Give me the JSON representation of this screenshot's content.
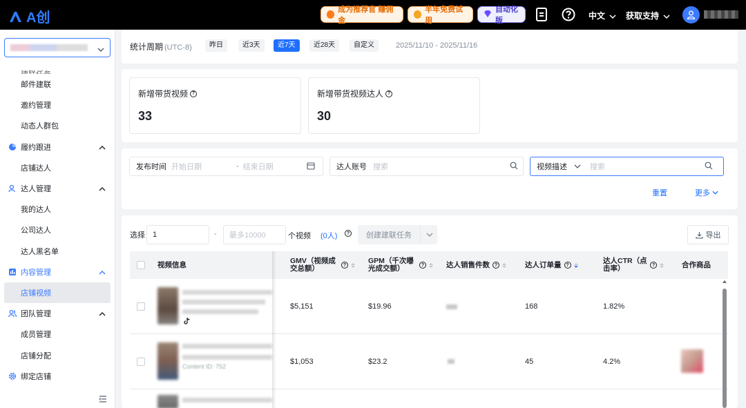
{
  "topbar": {
    "logo_text": "A创",
    "promo1": "成为推荐官 赚佣金",
    "promo2": "半年免费试用",
    "promo3": "自动化版",
    "lang": "中文",
    "support": "获取支持"
  },
  "sidebar": {
    "partial_item": "建联任务",
    "items_top": [
      "邮件建联",
      "邀约管理",
      "动态人群包"
    ],
    "groups": [
      {
        "label": "履约跟进",
        "items": [
          "店铺达人"
        ]
      },
      {
        "label": "达人管理",
        "items": [
          "我的达人",
          "公司达人",
          "达人黑名单"
        ]
      },
      {
        "label": "内容管理",
        "items": [
          "店铺视频"
        ]
      },
      {
        "label": "团队管理",
        "items": [
          "成员管理",
          "店铺分配"
        ]
      }
    ],
    "bottom_item": "绑定店铺"
  },
  "period": {
    "label": "统计周期",
    "timezone": "(UTC-8)",
    "chips": [
      "昨日",
      "近3天",
      "近7天",
      "近28天",
      "自定义"
    ],
    "active_chip": "近7天",
    "range": "2025/11/10 - 2025/11/16"
  },
  "stats": [
    {
      "title": "新增带货视频",
      "value": "33"
    },
    {
      "title": "新增带货视频达人",
      "value": "30"
    }
  ],
  "filters": {
    "publish_label": "发布时间",
    "start_placeholder": "开始日期",
    "separator": "-",
    "end_placeholder": "结束日期",
    "creator_label": "达人账号",
    "creator_placeholder": "搜索",
    "desc_select": "视频描述",
    "desc_placeholder": "搜索",
    "reset": "重置",
    "more": "更多"
  },
  "table_toolbar": {
    "select_label": "选择",
    "select_value": "1",
    "dash": "-",
    "max_placeholder": "最多10000",
    "unit": "个视频",
    "count": "(0人)",
    "create_task": "创建建联任务",
    "export": "导出"
  },
  "table": {
    "headers": [
      "视频信息",
      "GMV（视频成交总额）",
      "GPM（千次曝光成交额）",
      "达人销售件数",
      "达人订单量",
      "达人CTR（点击率）",
      "合作商品"
    ],
    "rows": [
      {
        "gmv": "$5,151",
        "gpm": "$19.96",
        "orders": "168",
        "ctr": "1.82%"
      },
      {
        "gmv": "$1,053",
        "gpm": "$23.2",
        "orders": "45",
        "ctr": "4.2%"
      }
    ],
    "row2_id_prefix": "Content ID: 752"
  }
}
